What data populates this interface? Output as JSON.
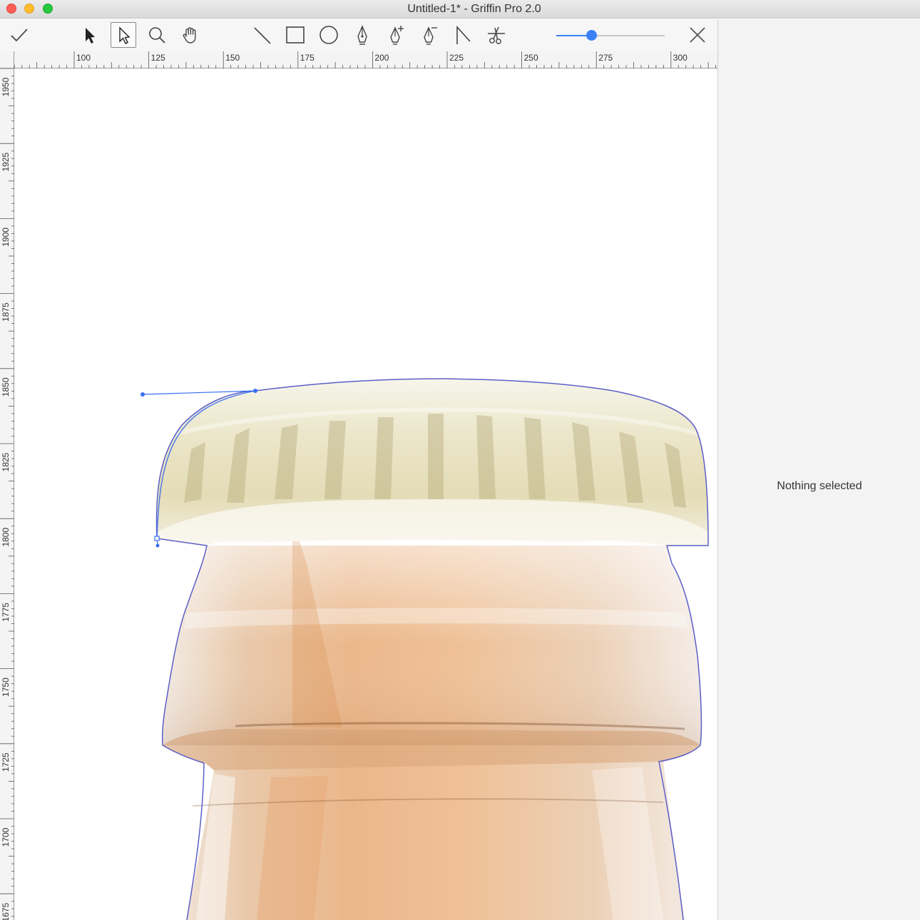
{
  "window": {
    "title": "Untitled-1* - Griffin Pro 2.0"
  },
  "toolbar": {
    "tools": [
      {
        "name": "confirm-icon"
      },
      {
        "name": "selection-arrow-icon"
      },
      {
        "name": "direct-selection-arrow-icon",
        "active": true
      },
      {
        "name": "zoom-icon"
      },
      {
        "name": "hand-icon"
      },
      {
        "name": "line-tool-icon"
      },
      {
        "name": "rectangle-tool-icon"
      },
      {
        "name": "ellipse-tool-icon"
      },
      {
        "name": "pen-tool-icon"
      },
      {
        "name": "add-anchor-point-icon"
      },
      {
        "name": "delete-anchor-point-icon"
      },
      {
        "name": "convert-anchor-point-icon"
      },
      {
        "name": "scissors-icon"
      }
    ],
    "zoom_slider": 0.32,
    "close_icon": "close-icon",
    "accent_color": "#3b82f6"
  },
  "rulers": {
    "horizontal_labels": [
      "100",
      "125",
      "150",
      "175",
      "200",
      "225",
      "250",
      "275",
      "300"
    ],
    "vertical_labels": [
      "1950",
      "1925",
      "1900",
      "1875",
      "1850",
      "1825",
      "1800",
      "1775",
      "1750",
      "1725",
      "1700",
      "1675"
    ]
  },
  "inspector": {
    "empty_message": "Nothing selected"
  },
  "canvas": {
    "path_color": "#5b5fc7",
    "selection_color": "#3a6ff0"
  }
}
